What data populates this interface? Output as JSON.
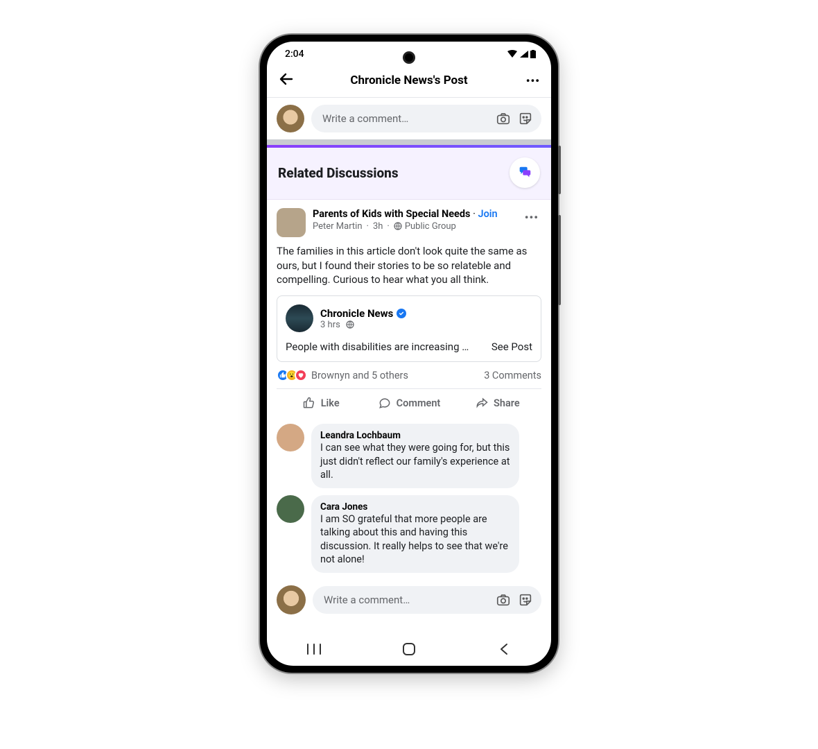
{
  "status": {
    "time": "2:04"
  },
  "header": {
    "title": "Chronicle News's Post"
  },
  "compose": {
    "placeholder": "Write a comment…"
  },
  "related": {
    "heading": "Related Discussions"
  },
  "post": {
    "group_name": "Parents of Kids with Special Needs",
    "join_label": "Join",
    "author": "Peter Martin",
    "time": "3h",
    "visibility": "Public Group",
    "body": "The families in this article don't look quite the same as ours, but I found their stories to be so relateble and compelling. Curious to hear what you all think.",
    "embed": {
      "source": "Chronicle News",
      "time": "3 hrs",
      "snippet": "People with disabilities are increasing …",
      "see_post": "See Post"
    },
    "reactions_text": "Brownyn and 5 others",
    "comments_count": "3 Comments",
    "actions": {
      "like": "Like",
      "comment": "Comment",
      "share": "Share"
    }
  },
  "comments": [
    {
      "name": "Leandra Lochbaum",
      "text": "I can see what they were going for, but this just didn't reflect our family's experience at all."
    },
    {
      "name": "Cara Jones",
      "text": "I am SO grateful that more people are talking about this and having this discussion. It really helps to see that we're not alone!"
    }
  ]
}
